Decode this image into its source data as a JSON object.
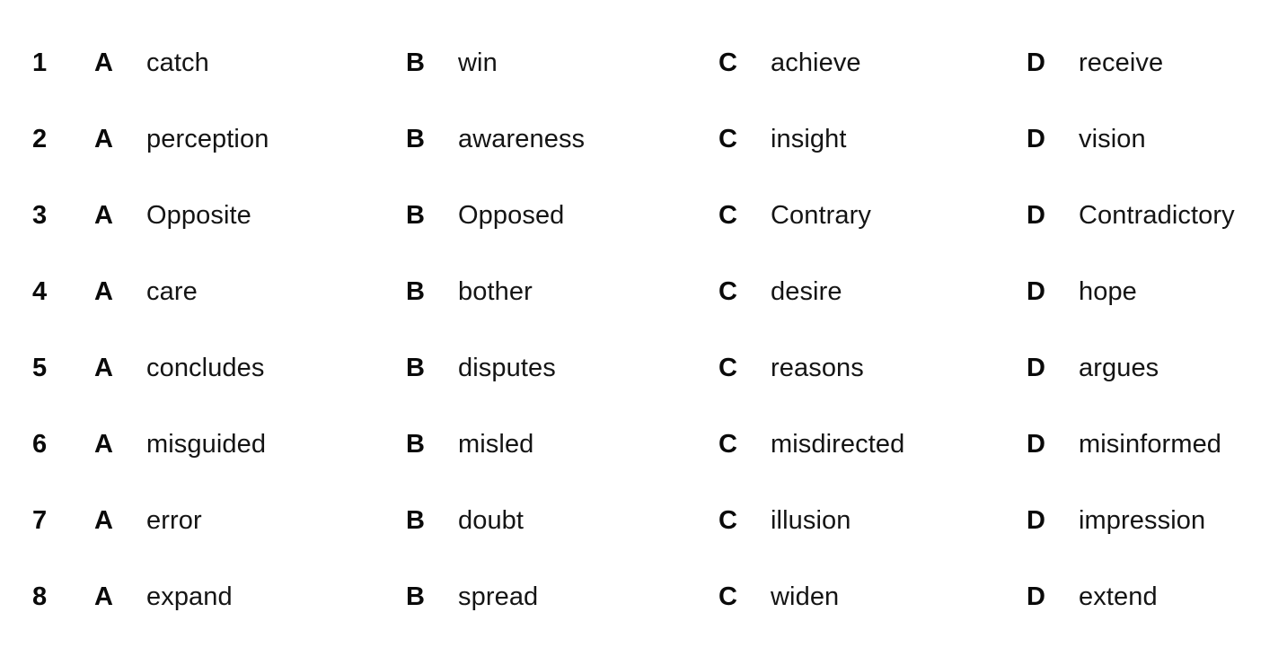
{
  "document": {
    "type": "multiple-choice-answer-options",
    "background_color": "#ffffff",
    "text_color": "#0a0a0a",
    "option_letters": [
      "A",
      "B",
      "C",
      "D"
    ],
    "question_count": 8
  },
  "questions": [
    {
      "number": "1",
      "options": [
        {
          "letter": "A",
          "text": "catch"
        },
        {
          "letter": "B",
          "text": "win"
        },
        {
          "letter": "C",
          "text": "achieve"
        },
        {
          "letter": "D",
          "text": "receive"
        }
      ]
    },
    {
      "number": "2",
      "options": [
        {
          "letter": "A",
          "text": "perception"
        },
        {
          "letter": "B",
          "text": "awareness"
        },
        {
          "letter": "C",
          "text": "insight"
        },
        {
          "letter": "D",
          "text": "vision"
        }
      ]
    },
    {
      "number": "3",
      "options": [
        {
          "letter": "A",
          "text": "Opposite"
        },
        {
          "letter": "B",
          "text": "Opposed"
        },
        {
          "letter": "C",
          "text": "Contrary"
        },
        {
          "letter": "D",
          "text": "Contradictory"
        }
      ]
    },
    {
      "number": "4",
      "options": [
        {
          "letter": "A",
          "text": "care"
        },
        {
          "letter": "B",
          "text": "bother"
        },
        {
          "letter": "C",
          "text": "desire"
        },
        {
          "letter": "D",
          "text": "hope"
        }
      ]
    },
    {
      "number": "5",
      "options": [
        {
          "letter": "A",
          "text": "concludes"
        },
        {
          "letter": "B",
          "text": "disputes"
        },
        {
          "letter": "C",
          "text": "reasons"
        },
        {
          "letter": "D",
          "text": "argues"
        }
      ]
    },
    {
      "number": "6",
      "options": [
        {
          "letter": "A",
          "text": "misguided"
        },
        {
          "letter": "B",
          "text": "misled"
        },
        {
          "letter": "C",
          "text": "misdirected"
        },
        {
          "letter": "D",
          "text": "misinformed"
        }
      ]
    },
    {
      "number": "7",
      "options": [
        {
          "letter": "A",
          "text": "error"
        },
        {
          "letter": "B",
          "text": "doubt"
        },
        {
          "letter": "C",
          "text": "illusion"
        },
        {
          "letter": "D",
          "text": "impression"
        }
      ]
    },
    {
      "number": "8",
      "options": [
        {
          "letter": "A",
          "text": "expand"
        },
        {
          "letter": "B",
          "text": "spread"
        },
        {
          "letter": "C",
          "text": "widen"
        },
        {
          "letter": "D",
          "text": "extend"
        }
      ]
    }
  ]
}
